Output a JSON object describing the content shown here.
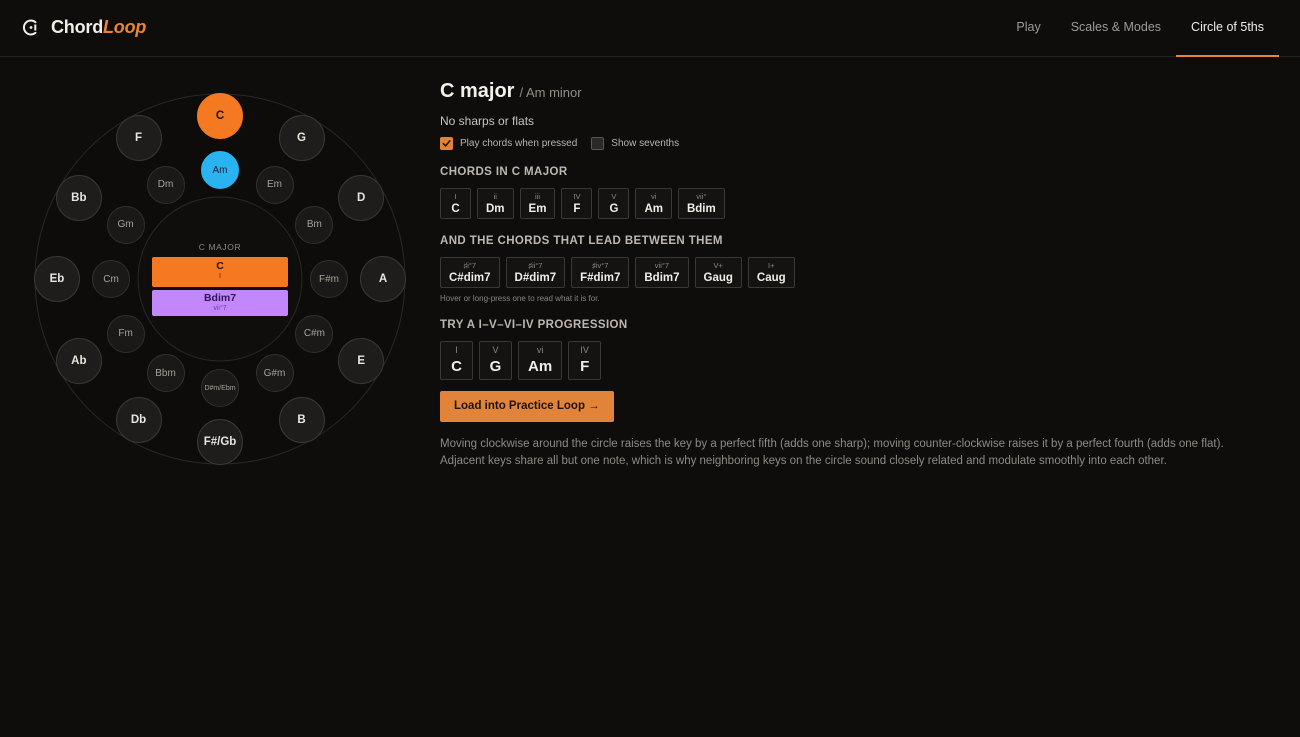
{
  "app": {
    "name_main": "Chord",
    "name_accent": "Loop"
  },
  "nav": [
    {
      "label": "Play",
      "active": false
    },
    {
      "label": "Scales & Modes",
      "active": false
    },
    {
      "label": "Circle of 5ths",
      "active": true
    }
  ],
  "circle": {
    "majors": [
      "C",
      "G",
      "D",
      "A",
      "E",
      "B",
      "F#/Gb",
      "Db",
      "Ab",
      "Eb",
      "Bb",
      "F"
    ],
    "minors": [
      "Am",
      "Em",
      "Bm",
      "F#m",
      "C#m",
      "G#m",
      "D#m/Ebm",
      "Bbm",
      "Fm",
      "Cm",
      "Gm",
      "Dm"
    ],
    "selected_major": 0,
    "selected_minor": 0,
    "center_label": "C MAJOR",
    "center_chords": [
      {
        "name": "C",
        "roman": "I"
      },
      {
        "name": "Bdim7",
        "roman": "vii°7"
      }
    ]
  },
  "panel": {
    "major": "C major",
    "minor": "/ Am minor",
    "signature": "No sharps or flats",
    "options": [
      {
        "label": "Play chords when pressed",
        "checked": true
      },
      {
        "label": "Show sevenths",
        "checked": false
      }
    ],
    "diatonic_title": "CHORDS IN C MAJOR",
    "diatonic": [
      {
        "roman": "I",
        "chord": "C"
      },
      {
        "roman": "ii",
        "chord": "Dm"
      },
      {
        "roman": "iii",
        "chord": "Em"
      },
      {
        "roman": "IV",
        "chord": "F"
      },
      {
        "roman": "V",
        "chord": "G"
      },
      {
        "roman": "vi",
        "chord": "Am"
      },
      {
        "roman": "vii°",
        "chord": "Bdim"
      }
    ],
    "passing_title": "AND THE CHORDS THAT LEAD BETWEEN THEM",
    "passing": [
      {
        "roman": "♯i°7",
        "chord": "C#dim7"
      },
      {
        "roman": "♯ii°7",
        "chord": "D#dim7"
      },
      {
        "roman": "♯iv°7",
        "chord": "F#dim7"
      },
      {
        "roman": "vii°7",
        "chord": "Bdim7"
      },
      {
        "roman": "V+",
        "chord": "Gaug"
      },
      {
        "roman": "I+",
        "chord": "Caug"
      }
    ],
    "hint": "Hover or long-press one to read what it is for.",
    "progression_title": "TRY A I–V–VI–IV PROGRESSION",
    "progression": [
      {
        "roman": "I",
        "chord": "C"
      },
      {
        "roman": "V",
        "chord": "G"
      },
      {
        "roman": "vi",
        "chord": "Am"
      },
      {
        "roman": "IV",
        "chord": "F"
      }
    ],
    "load_button": "Load into Practice Loop →",
    "description": "Moving clockwise around the circle raises the key by a perfect fifth (adds one sharp); moving counter-clockwise raises it by a perfect fourth (adds one flat). Adjacent keys share all but one note, which is why neighboring keys on the circle sound closely related and modulate smoothly into each other."
  },
  "colors": {
    "accent": "#e9852f",
    "major_selected": "#f47921",
    "minor_selected": "#29b3f0",
    "dim_chord": "#c287fb"
  },
  "icons": {
    "logo": "loop-icon",
    "check": "check-icon"
  }
}
